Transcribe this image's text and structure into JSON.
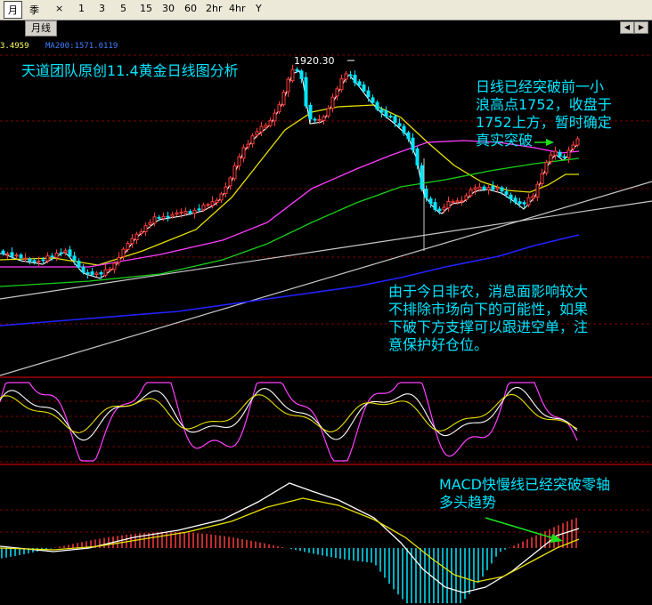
{
  "toolbar": {
    "items": [
      "月",
      "季",
      "×",
      "1",
      "3",
      "5",
      "15",
      "30",
      "60",
      "2hr",
      "4hr",
      "Y"
    ],
    "sub_tab": "月线"
  },
  "ma_legend": {
    "ma_partial": "3.4959",
    "ma200": "MA200:1571.0119"
  },
  "annotations": {
    "title": "天道团队原创11.4黄金日线图分析",
    "peak_label": "1920.30",
    "breakout": [
      "日线已经突破前一小",
      "浪高点1752，收盘于",
      "1752上方，暂时确定",
      "真实突破"
    ],
    "risk": [
      "由于今日非农，消息面影响较大",
      "不排除市场向下的可能性，如果",
      "下破下方支撑可以跟进空单，注",
      "意保护好仓位。"
    ],
    "macd": [
      "MACD快慢线已经突破零轴",
      "多头趋势"
    ]
  },
  "chart_data": {
    "type": "candlestick",
    "panels": [
      "price",
      "kdj",
      "macd"
    ],
    "price": {
      "peak": 1920.3,
      "breakout_level": 1752
    },
    "colors": {
      "up": "#ff3b3b",
      "down": "#00e5ff",
      "ma_short": "#ffffff",
      "ma_mid": "#e8e000",
      "ma_long": "#ff3cff",
      "ma_longer": "#18d018",
      "ma200": "#2222ff",
      "trend": "#c8c8c8",
      "arrow": "#1ee01e",
      "annot": "#00e5ff"
    }
  }
}
